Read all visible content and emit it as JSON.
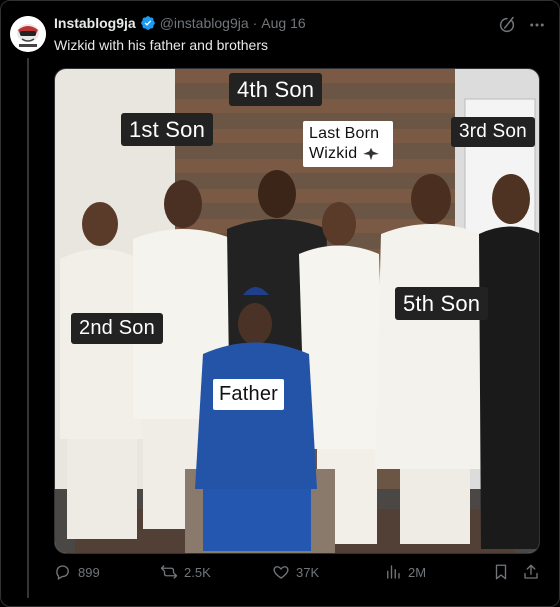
{
  "tweet": {
    "author_name": "Instablog9ja",
    "handle": "@instablog9ja",
    "separator": "·",
    "date": "Aug 16",
    "text": "Wizkid with his father and brothers",
    "verified": true,
    "icons": [
      "grok-icon",
      "more-icon"
    ]
  },
  "photo": {
    "labels": {
      "first_son": "1st Son",
      "second_son": "2nd Son",
      "third_son": "3rd Son",
      "fourth_son": "4th Son",
      "fifth_son": "5th Son",
      "last_born_line1": "Last Born",
      "last_born_line2": "Wizkid",
      "father": "Father"
    }
  },
  "actions": {
    "replies": "899",
    "reposts": "2.5K",
    "likes": "37K",
    "views": "2M"
  },
  "colors": {
    "background": "#000000",
    "text_primary": "#e7e9ea",
    "text_secondary": "#71767b",
    "verified_blue": "#1d9bf0",
    "border": "#2f3336"
  }
}
